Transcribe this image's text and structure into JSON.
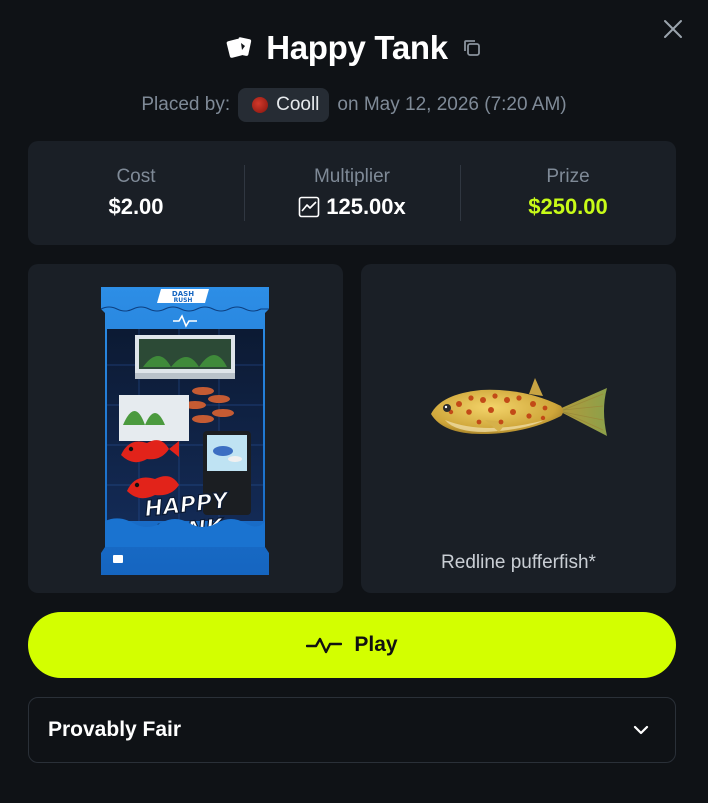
{
  "header": {
    "title": "Happy Tank",
    "placed_by_label": "Placed by:",
    "username": "Cooll",
    "placed_on": "on May 12, 2026 (7:20 AM)"
  },
  "stats": {
    "cost_label": "Cost",
    "cost_value": "$2.00",
    "multiplier_label": "Multiplier",
    "multiplier_value": "125.00x",
    "prize_label": "Prize",
    "prize_value": "$250.00"
  },
  "pack": {
    "brand_line1": "DASH",
    "brand_line2": "RUSH",
    "name_line1": "HAPPY",
    "name_line2": "TANK"
  },
  "item": {
    "name": "Redline pufferfish*"
  },
  "actions": {
    "play_label": "Play",
    "provably_fair_label": "Provably Fair"
  },
  "colors": {
    "background": "#0f1216",
    "panel": "#1a1f26",
    "accent": "#d3ff00",
    "prize": "#c8fb18",
    "muted": "#7f8a97"
  },
  "icons": {
    "close": "close-icon",
    "logo": "cards-logo-icon",
    "copy": "copy-icon",
    "multiplier": "trend-chart-icon",
    "play": "pulse-icon",
    "chevron": "chevron-down-icon"
  }
}
